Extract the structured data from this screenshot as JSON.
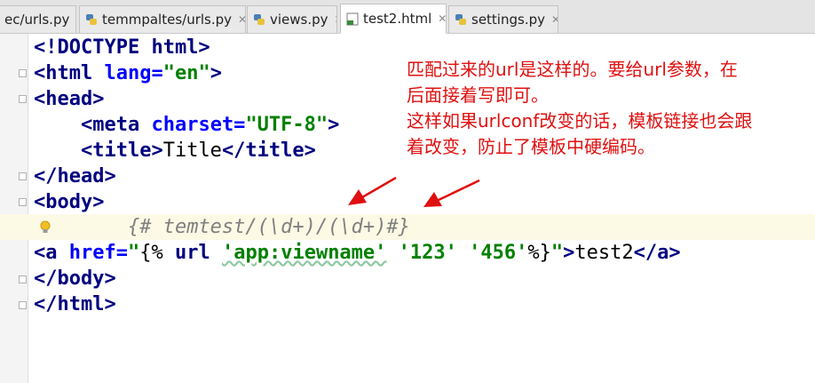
{
  "tabs": [
    {
      "label": "ec/urls.py",
      "icon": "python-file-icon",
      "active": false
    },
    {
      "label": "temmpaltes/urls.py",
      "icon": "python-file-icon",
      "active": false
    },
    {
      "label": "views.py",
      "icon": "python-file-icon",
      "active": false
    },
    {
      "label": "test2.html",
      "icon": "html-file-icon",
      "active": true
    },
    {
      "label": "settings.py",
      "icon": "python-file-icon",
      "active": false
    }
  ],
  "code": {
    "l1_tag": "<!DOCTYPE html>",
    "l2_open": "<html",
    "l2_attr": "lang=",
    "l2_val": "\"en\"",
    "l2_close": ">",
    "l3": "<head>",
    "l4_open": "<meta",
    "l4_attr": "charset=",
    "l4_val": "\"UTF-8\"",
    "l4_close": ">",
    "l5_open": "<title>",
    "l5_text": "Title",
    "l5_close": "</title>",
    "l6": "</head>",
    "l7": "<body>",
    "l8_comment": "{# temtest/(\\d+)/(\\d+)#}",
    "l9_open": "<a",
    "l9_attr": "href=",
    "l9_q": "\"",
    "l9_tpl_open": "{% ",
    "l9_url": "url",
    "l9_s1": "'app:viewname'",
    "l9_s2": "'123'",
    "l9_s3": "'456'",
    "l9_tpl_close": "%}",
    "l9_q2": "\"",
    "l9_gt": ">",
    "l9_text": "test2",
    "l9_end": "</a>",
    "l10": "</body>",
    "l11": "</html>"
  },
  "annotation": {
    "line1": "匹配过来的url是这样的。要给url参数，在",
    "line2": "后面接着写即可。",
    "line3": "这样如果urlconf改变的话，模板链接也会跟",
    "line4": "着改变，防止了模板中硬编码。"
  },
  "colors": {
    "tag": "#000080",
    "attr": "#0000ff",
    "string": "#008000",
    "comment": "#808080",
    "annotation": "#e01010"
  }
}
